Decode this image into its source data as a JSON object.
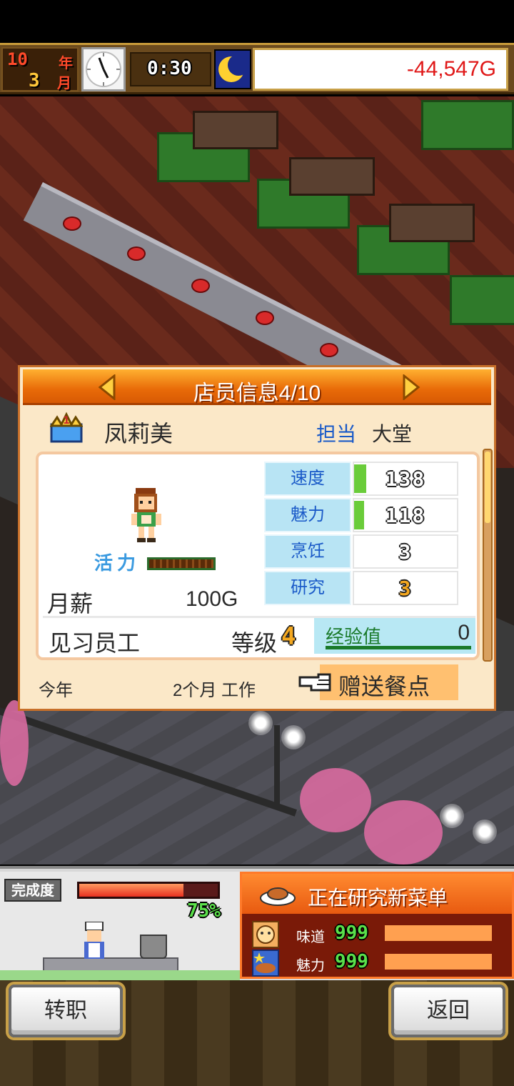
{
  "status_bar": {
    "year": "10",
    "year_unit": "年",
    "month": "3",
    "month_unit": "月",
    "time": "0:30",
    "money": "-44,547G",
    "money_color": "#e01818"
  },
  "dialog": {
    "title": "店员信息4/10",
    "staff_name": "凤莉美",
    "assignment_label": "担当",
    "assignment_value": "大堂",
    "vigor_label": "活力",
    "salary_label": "月薪",
    "salary_value": "100G",
    "stats": [
      {
        "name": "速度",
        "value": "138",
        "fill": 0.12
      },
      {
        "name": "魅力",
        "value": "118",
        "fill": 0.1
      },
      {
        "name": "烹饪",
        "value": "3",
        "fill": 0
      },
      {
        "name": "研究",
        "value": "3",
        "fill": 0
      }
    ],
    "rank_name": "见习员工",
    "level_label": "等级",
    "level_value": "4",
    "exp_label": "经验值",
    "exp_value": "0",
    "work_label": "今年",
    "work_duration": "2个月 工作",
    "gift_button": "赠送餐点",
    "icons": [
      "rank-badge-icon",
      "arrow-left-icon",
      "arrow-right-icon",
      "pointing-hand-icon"
    ]
  },
  "research": {
    "completion_label": "完成度",
    "completion_percent": "75%",
    "completion_fraction": 0.75,
    "title": "正在研究新菜单",
    "taste_label": "味道",
    "taste_value": "999",
    "charm_label": "魅力",
    "charm_value": "999",
    "accent_color": "#e85a10"
  },
  "buttons": {
    "change_job": "转职",
    "back": "返回"
  }
}
